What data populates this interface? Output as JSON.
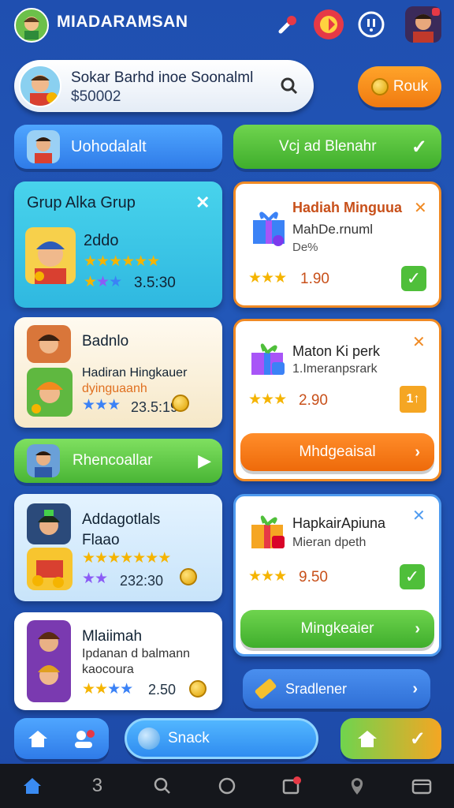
{
  "header": {
    "title": "MIADARAMSAN",
    "icons": [
      "avatar-icon",
      "tool-icon",
      "fire-badge-icon",
      "info-icon",
      "user-avatar-icon"
    ]
  },
  "search": {
    "name": "Sokar Barhd inoe Soonalml",
    "value": "$50002",
    "round_button": "Rouk"
  },
  "row_buttons": {
    "left_label": "Uohodalalt",
    "right_label": "Vcj ad Blenahr"
  },
  "left_cards": [
    {
      "title": "Grup Alka Grup",
      "line1": "2ddo",
      "line2": "3.5:30"
    },
    {
      "title": "Badnlo",
      "line1": "Hadiran Hingkauer",
      "line2": "dyinguaanh",
      "line3": "23.5:19"
    }
  ],
  "green_bar": {
    "label": "Rhencoallar"
  },
  "left_cards2": [
    {
      "title": "Addagotlals",
      "line1": "Flaao",
      "value": "232:30"
    },
    {
      "title": "Mlaiimah",
      "line1": "Ipdanan d balmann",
      "line2": "kaocoura",
      "value": "2.50"
    }
  ],
  "right_cards": [
    {
      "title": "Hadiah Minguua",
      "sub1": "MahDe.rnuml",
      "sub2": "De%",
      "value": "1.90"
    },
    {
      "title": "Maton Ki perk",
      "sub1": "1.Imeranpsrark",
      "value": "2.90",
      "button": "Mhdgeaisal"
    },
    {
      "title": "HapkairApiuna",
      "sub1": "Mieran dpeth",
      "value": "9.50",
      "button": "Mingkeaier"
    }
  ],
  "sradlener": {
    "label": "Sradlener"
  },
  "bottom_row": {
    "search_label": "Snack"
  },
  "navbar": [
    "home-icon",
    "3-icon",
    "search-icon",
    "circle-icon",
    "notification-icon",
    "location-icon",
    "wallet-icon"
  ],
  "colors": {
    "bg": "#2257b8",
    "green": "#4fbf3a",
    "orange": "#f47a14",
    "cyan": "#39c5e4",
    "blue": "#3a8bf2"
  }
}
